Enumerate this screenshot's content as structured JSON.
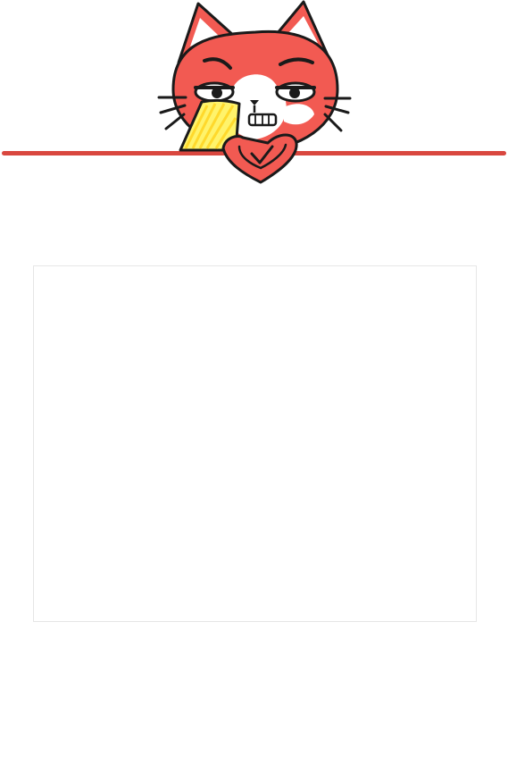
{
  "colors": {
    "accent": "#d9473f",
    "cat_body": "#f25a52",
    "fan": "#fff36b",
    "panel_border": "#e6e6e6"
  },
  "header": {
    "mascot": {
      "icon": "cat-mascot-with-fan-icon"
    }
  },
  "main": {
    "panel": {
      "content": ""
    }
  }
}
